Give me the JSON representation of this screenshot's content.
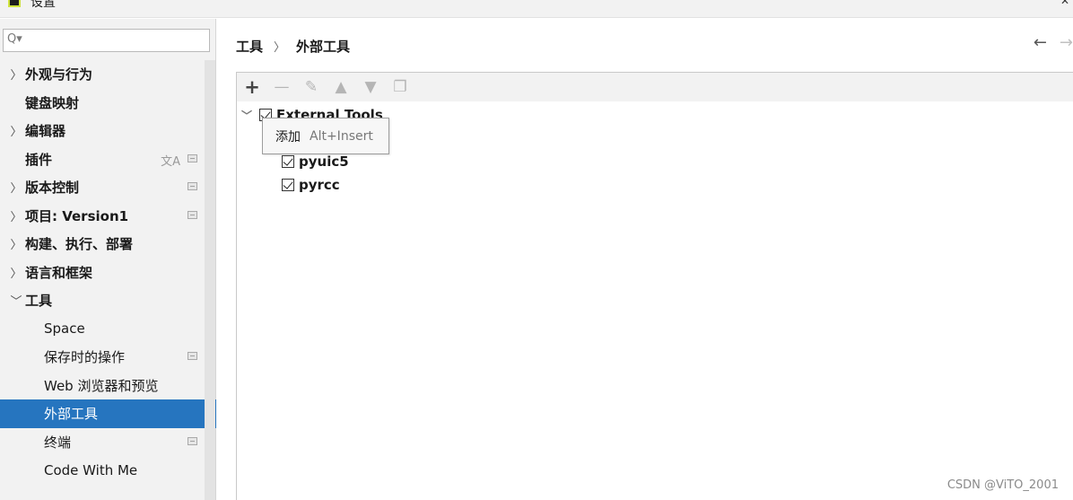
{
  "window": {
    "title": "设置"
  },
  "search": {
    "placeholder": ""
  },
  "sidebar": {
    "items": [
      {
        "label": "外观与行为"
      },
      {
        "label": "键盘映射"
      },
      {
        "label": "编辑器"
      },
      {
        "label": "插件"
      },
      {
        "label": "版本控制"
      },
      {
        "label": "项目: Version1"
      },
      {
        "label": "构建、执行、部署"
      },
      {
        "label": "语言和框架"
      },
      {
        "label": "工具"
      },
      {
        "label": "Space"
      },
      {
        "label": "保存时的操作"
      },
      {
        "label": "Web 浏览器和预览"
      },
      {
        "label": "外部工具"
      },
      {
        "label": "终端"
      },
      {
        "label": "Code With Me"
      }
    ]
  },
  "breadcrumb": {
    "parent": "工具",
    "current": "外部工具"
  },
  "tree": {
    "root": "External Tools",
    "children": [
      "pyuic5",
      "pyrcc"
    ]
  },
  "tooltip": {
    "label": "添加",
    "shortcut": "Alt+Insert"
  },
  "watermark": "CSDN @ViTO_2001",
  "colors": {
    "selected": "#2675bf",
    "sidebar_bg": "#f2f2f2"
  }
}
